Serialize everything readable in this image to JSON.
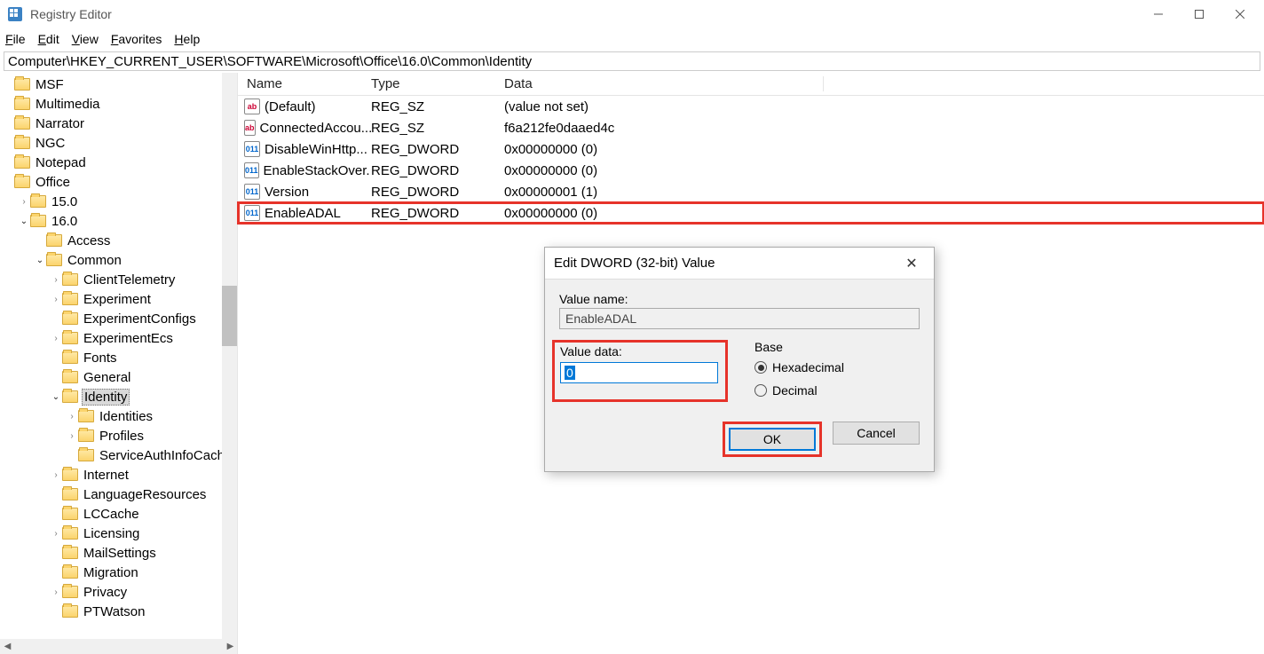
{
  "window": {
    "title": "Registry Editor"
  },
  "menu": {
    "file": "File",
    "edit": "Edit",
    "view": "View",
    "favorites": "Favorites",
    "help": "Help"
  },
  "address": "Computer\\HKEY_CURRENT_USER\\SOFTWARE\\Microsoft\\Office\\16.0\\Common\\Identity",
  "tree": [
    {
      "indent": 0,
      "chev": "none",
      "label": "MSF"
    },
    {
      "indent": 0,
      "chev": "none",
      "label": "Multimedia"
    },
    {
      "indent": 0,
      "chev": "none",
      "label": "Narrator"
    },
    {
      "indent": 0,
      "chev": "none",
      "label": "NGC"
    },
    {
      "indent": 0,
      "chev": "none",
      "label": "Notepad"
    },
    {
      "indent": 0,
      "chev": "none",
      "label": "Office"
    },
    {
      "indent": 1,
      "chev": "closed",
      "label": "15.0"
    },
    {
      "indent": 1,
      "chev": "open",
      "label": "16.0"
    },
    {
      "indent": 2,
      "chev": "none",
      "label": "Access"
    },
    {
      "indent": 2,
      "chev": "open",
      "label": "Common"
    },
    {
      "indent": 3,
      "chev": "closed",
      "label": "ClientTelemetry"
    },
    {
      "indent": 3,
      "chev": "closed",
      "label": "Experiment"
    },
    {
      "indent": 3,
      "chev": "none",
      "label": "ExperimentConfigs"
    },
    {
      "indent": 3,
      "chev": "closed",
      "label": "ExperimentEcs"
    },
    {
      "indent": 3,
      "chev": "none",
      "label": "Fonts"
    },
    {
      "indent": 3,
      "chev": "none",
      "label": "General"
    },
    {
      "indent": 3,
      "chev": "open",
      "label": "Identity",
      "selected": true
    },
    {
      "indent": 4,
      "chev": "closed",
      "label": "Identities"
    },
    {
      "indent": 4,
      "chev": "closed",
      "label": "Profiles"
    },
    {
      "indent": 4,
      "chev": "none",
      "label": "ServiceAuthInfoCache"
    },
    {
      "indent": 3,
      "chev": "closed",
      "label": "Internet"
    },
    {
      "indent": 3,
      "chev": "none",
      "label": "LanguageResources"
    },
    {
      "indent": 3,
      "chev": "none",
      "label": "LCCache"
    },
    {
      "indent": 3,
      "chev": "closed",
      "label": "Licensing"
    },
    {
      "indent": 3,
      "chev": "none",
      "label": "MailSettings"
    },
    {
      "indent": 3,
      "chev": "none",
      "label": "Migration"
    },
    {
      "indent": 3,
      "chev": "closed",
      "label": "Privacy"
    },
    {
      "indent": 3,
      "chev": "none",
      "label": "PTWatson"
    }
  ],
  "list": {
    "headers": {
      "name": "Name",
      "type": "Type",
      "data": "Data"
    },
    "rows": [
      {
        "icon": "sz",
        "name": "(Default)",
        "type": "REG_SZ",
        "data": "(value not set)"
      },
      {
        "icon": "sz",
        "name": "ConnectedAccou...",
        "type": "REG_SZ",
        "data": "f6a212fe0daaed4c"
      },
      {
        "icon": "dw",
        "name": "DisableWinHttp...",
        "type": "REG_DWORD",
        "data": "0x00000000 (0)"
      },
      {
        "icon": "dw",
        "name": "EnableStackOver...",
        "type": "REG_DWORD",
        "data": "0x00000000 (0)"
      },
      {
        "icon": "dw",
        "name": "Version",
        "type": "REG_DWORD",
        "data": "0x00000001 (1)"
      },
      {
        "icon": "dw",
        "name": "EnableADAL",
        "type": "REG_DWORD",
        "data": "0x00000000 (0)",
        "highlighted": true
      }
    ]
  },
  "dialog": {
    "title": "Edit DWORD (32-bit) Value",
    "value_name_label": "Value name:",
    "value_name": "EnableADAL",
    "value_data_label": "Value data:",
    "value_data": "0",
    "base_label": "Base",
    "hex_label": "Hexadecimal",
    "dec_label": "Decimal",
    "ok": "OK",
    "cancel": "Cancel"
  }
}
